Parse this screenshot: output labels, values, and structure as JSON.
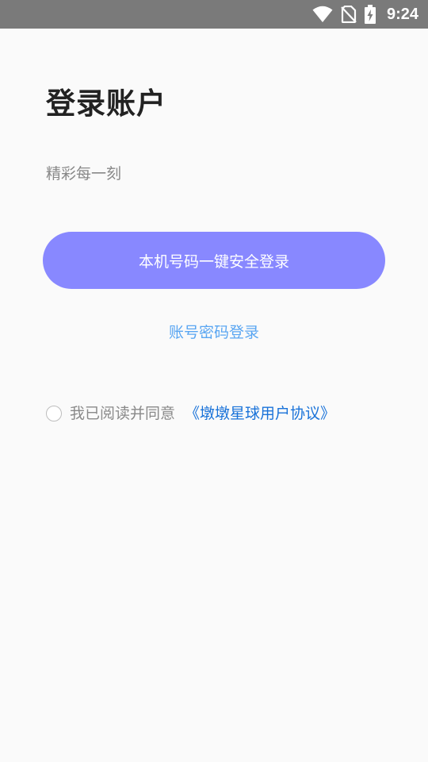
{
  "status_bar": {
    "time": "9:24",
    "icons": [
      "wifi-icon",
      "no-sim-icon",
      "battery-charging-icon"
    ]
  },
  "login": {
    "title": "登录账户",
    "subtitle": "精彩每一刻",
    "one_key_label": "本机号码一键安全登录",
    "password_login_label": "账号密码登录",
    "agreement_prefix": "我已阅读并同意",
    "agreement_link": "《墩墩星球用户协议》",
    "agreement_checked": false
  },
  "colors": {
    "accent_button": "#8888ff",
    "link_light": "#5aa6f2",
    "link_dark": "#1a73d9",
    "status_bar": "#7a7a7a"
  }
}
